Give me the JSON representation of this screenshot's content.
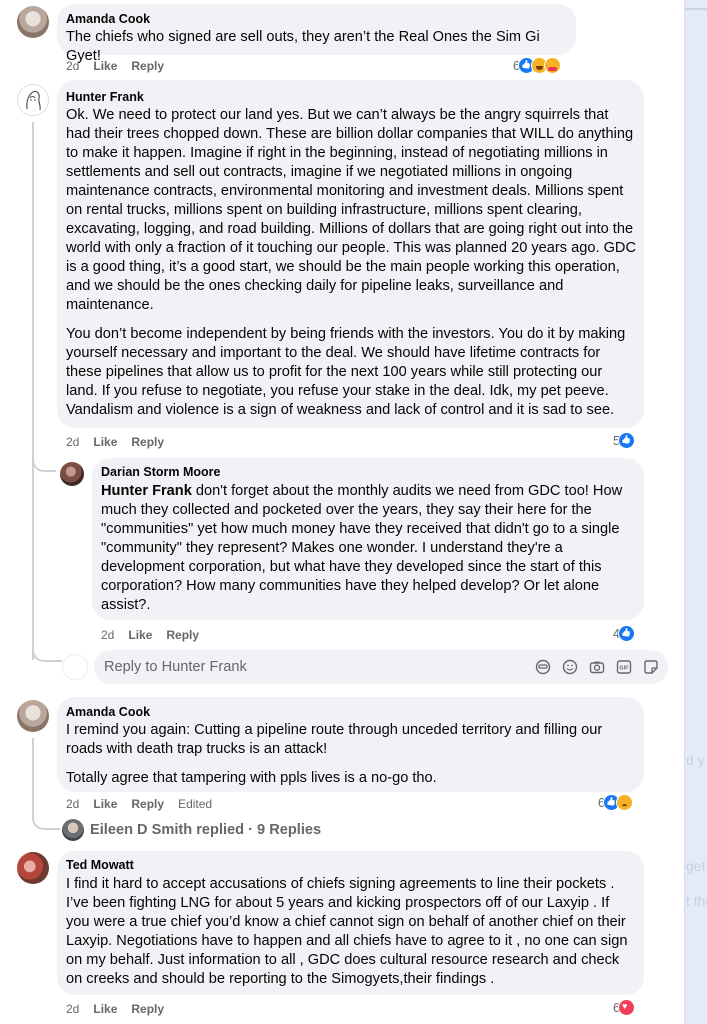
{
  "comments": [
    {
      "author": "Amanda Cook",
      "text": "The chiefs who signed are sell outs, they aren’t the Real Ones the Sim Gi Gyet!",
      "age": "2d",
      "like_label": "Like",
      "reply_label": "Reply",
      "reaction_count": "6",
      "reactions": [
        "like",
        "haha",
        "care"
      ]
    },
    {
      "author": "Hunter Frank",
      "paragraphs": [
        "Ok. We need to protect our land yes. But we can’t always be the angry squirrels that had their trees chopped down. These are billion dollar companies that WILL do anything to make it happen. Imagine if right in the beginning, instead of negotiating millions in settlements and sell out contracts, imagine if we negotiated millions in ongoing maintenance contracts, environmental monitoring and investment deals. Millions spent on rental trucks, millions spent on building infrastructure, millions spent clearing, excavating, logging, and road building. Millions of dollars that are going right out into the world with only a fraction of it touching our people. This was planned 20 years ago. GDC is a good thing, it’s a good start, we should be the main people working this operation, and we should be the ones checking daily for pipeline leaks, surveillance and maintenance.",
        "You don’t become independent by being friends with the investors. You do it by making yourself necessary and important to the deal. We should have lifetime contracts for these pipelines that allow us to profit for the next 100 years while still protecting our land. If you refuse to negotiate, you refuse your stake in the deal. Idk, my pet peeve. Vandalism and violence is a sign of weakness and lack of control and it is sad to see."
      ],
      "age": "2d",
      "like_label": "Like",
      "reply_label": "Reply",
      "reaction_count": "5",
      "reactions": [
        "like"
      ]
    },
    {
      "author": "Darian Storm Moore",
      "mention": "Hunter Frank",
      "text": " don't forget about the monthly audits we need from GDC too! How much they collected and pocketed over the years, they say their here for the \"communities\" yet how much money have they received that didn't go to a single \"community\" they represent? Makes one wonder. I understand they're a development corporation, but what have they developed since the start of this corporation? How many communities have they helped develop? Or let alone assist?.",
      "age": "2d",
      "like_label": "Like",
      "reply_label": "Reply",
      "reaction_count": "4",
      "reactions": [
        "like"
      ]
    },
    {
      "author": "Amanda Cook",
      "paragraphs": [
        "I remind you again: Cutting a pipeline route through unceded territory and filling our roads with death trap trucks is an attack!",
        "Totally agree that tampering with ppls lives is a no-go tho."
      ],
      "age": "2d",
      "like_label": "Like",
      "reply_label": "Reply",
      "edited_label": "Edited",
      "reaction_count": "6",
      "reactions": [
        "like",
        "sad"
      ]
    },
    {
      "author": "Ted Mowatt",
      "text": "I find it hard to accept accusations of chiefs signing agreements to line their pockets . I’ve been fighting LNG for about 5 years and kicking prospectors off of our Laxyip . If you were a true chief you’d know a chief cannot sign on behalf of another chief on their Laxyip. Negotiations have to happen and all chiefs have to agree to it , no one can sign on my behalf. Just information to all , GDC does cultural resource research and check on creeks and should be reporting to the Simogyets,their findings .",
      "age": "2d",
      "like_label": "Like",
      "reply_label": "Reply",
      "reaction_count": "6",
      "reactions": [
        "love"
      ]
    }
  ],
  "reply_box": {
    "placeholder": "Reply to Hunter Frank",
    "tools": [
      "avatar-sticker-icon",
      "emoji-icon",
      "camera-icon",
      "gif-icon",
      "sticker-icon"
    ]
  },
  "replied_summary": "Eileen D Smith replied · 9 Replies",
  "side_fragments": [
    "d y",
    "get",
    "t the"
  ],
  "colors": {
    "bubble": "#f0f2f5",
    "meta_text": "#65676b",
    "like_blue": "#1877f2",
    "love_red": "#f33e58",
    "reaction_yellow": "#f7b125"
  }
}
